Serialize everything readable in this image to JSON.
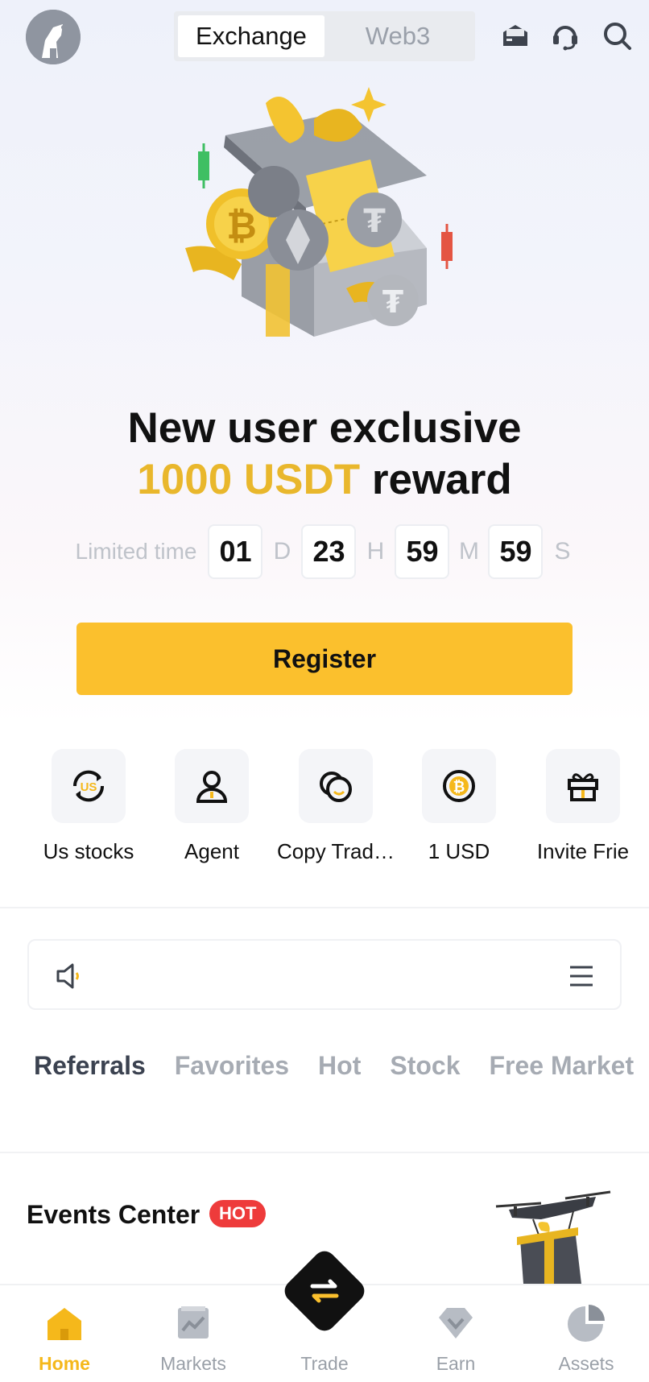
{
  "header": {
    "tabs": [
      {
        "label": "Exchange",
        "active": true
      },
      {
        "label": "Web3",
        "active": false
      }
    ],
    "icons": [
      "mail-icon",
      "support-icon",
      "search-icon"
    ]
  },
  "hero": {
    "headline_line1": "New user exclusive",
    "reward_amount": "1000 USDT",
    "reward_suffix": "reward",
    "countdown": {
      "label": "Limited time",
      "days": "01",
      "days_unit": "D",
      "hours": "23",
      "hours_unit": "H",
      "minutes": "59",
      "minutes_unit": "M",
      "seconds": "59",
      "seconds_unit": "S"
    },
    "register_label": "Register"
  },
  "shortcuts": [
    {
      "label": "Us stocks",
      "icon": "us-stocks-icon"
    },
    {
      "label": "Agent",
      "icon": "agent-icon"
    },
    {
      "label": "Copy Trad…",
      "icon": "copy-trade-icon"
    },
    {
      "label": "1 USD",
      "icon": "bitcoin-icon"
    },
    {
      "label": "Invite Frie",
      "icon": "gift-icon"
    }
  ],
  "market_tabs": [
    {
      "label": "Referrals",
      "active": true
    },
    {
      "label": "Favorites",
      "active": false
    },
    {
      "label": "Hot",
      "active": false
    },
    {
      "label": "Stock",
      "active": false
    },
    {
      "label": "Free Market",
      "active": false
    }
  ],
  "events": {
    "title": "Events Center",
    "badge": "HOT"
  },
  "bottom_nav": [
    {
      "label": "Home",
      "active": true
    },
    {
      "label": "Markets",
      "active": false
    },
    {
      "label": "Trade",
      "active": false
    },
    {
      "label": "Earn",
      "active": false
    },
    {
      "label": "Assets",
      "active": false
    }
  ],
  "colors": {
    "accent": "#fbc02d",
    "reward_gold": "#e9b72c",
    "hot_red": "#ee3b3b",
    "nav_active": "#f5b81b"
  }
}
